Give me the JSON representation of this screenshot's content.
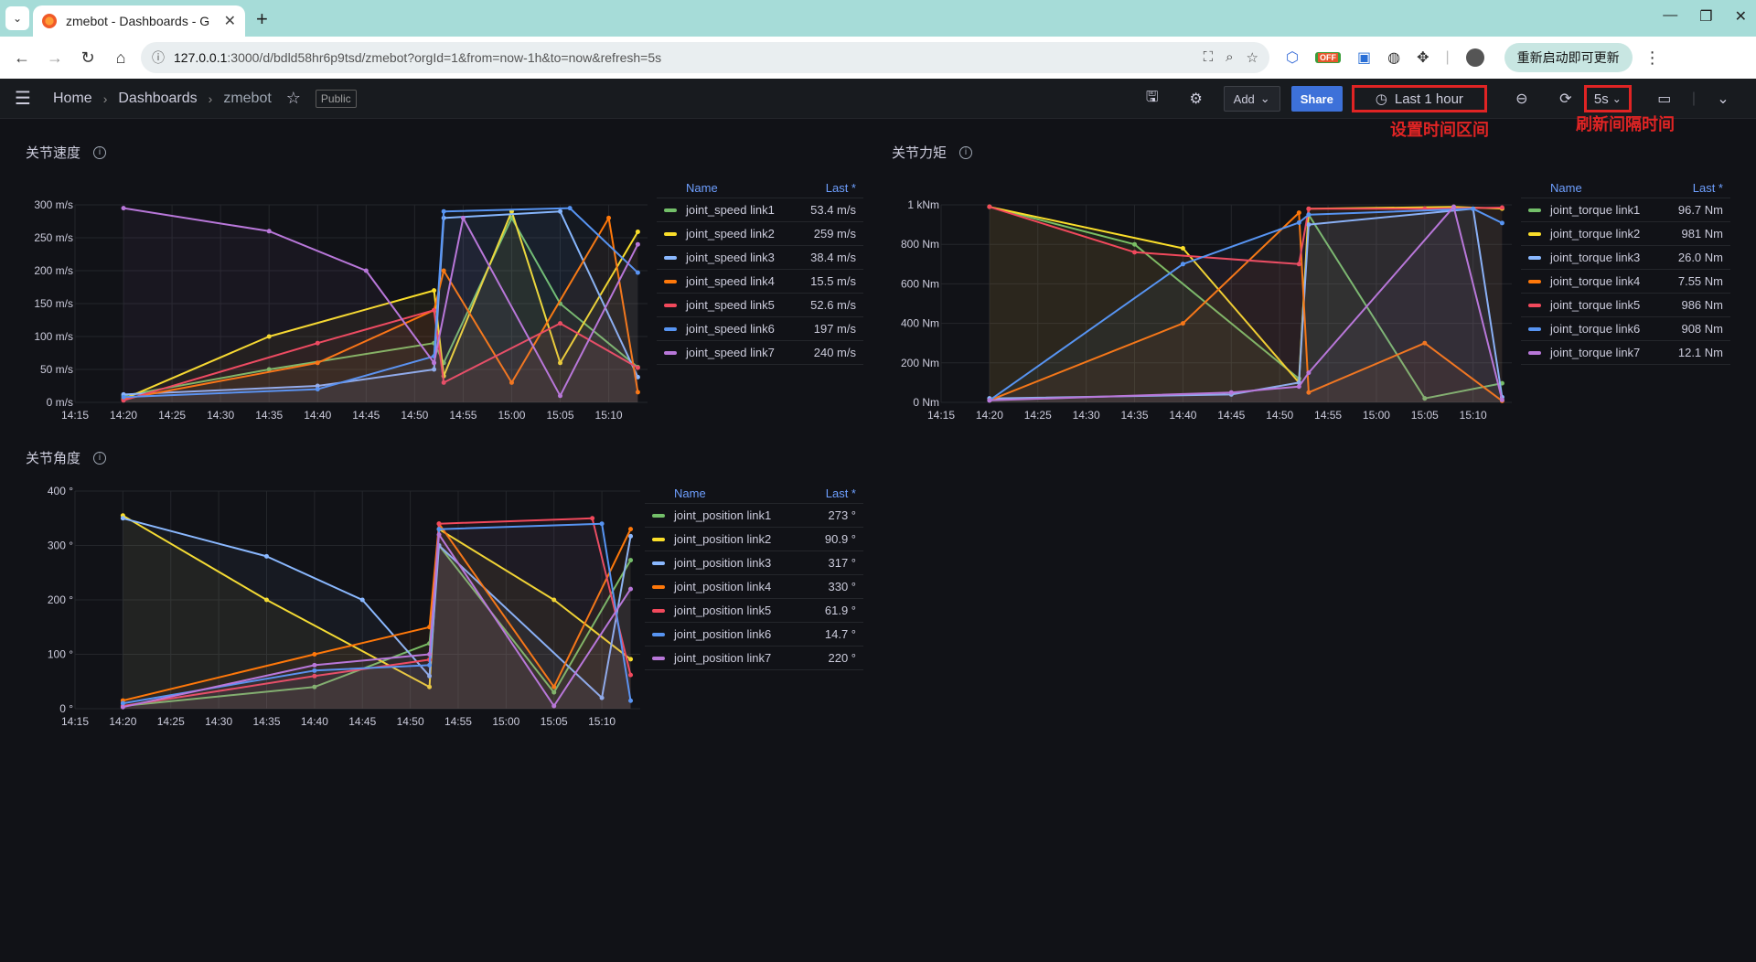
{
  "browser": {
    "tab_title": "zmebot - Dashboards - G",
    "url_host": "127.0.0.1",
    "url_path": ":3000/d/bdld58hr6p9tsd/zmebot?orgId=1&from=now-1h&to=now&refresh=5s",
    "update_button": "重新启动即可更新",
    "ext_off_label": "OFF"
  },
  "nav": {
    "home": "Home",
    "dashboards": "Dashboards",
    "dashboard_name": "zmebot",
    "public_badge": "Public",
    "add_label": "Add",
    "share_label": "Share",
    "time_range": "Last 1 hour",
    "refresh_interval": "5s"
  },
  "annotations": {
    "time_range_note": "设置时间区间",
    "refresh_note": "刷新间隔时间"
  },
  "colors": {
    "link1": "#73bf69",
    "link2": "#fade2a",
    "link3": "#8ab8ff",
    "link4": "#ff780a",
    "link5": "#f2495c",
    "link6": "#5794f2",
    "link7": "#b877d9"
  },
  "panels": [
    {
      "title": "关节速度",
      "legend_name_header": "Name",
      "legend_last_header": "Last *",
      "legend": [
        {
          "name": "joint_speed link1",
          "value": "53.4 m/s"
        },
        {
          "name": "joint_speed link2",
          "value": "259 m/s"
        },
        {
          "name": "joint_speed link3",
          "value": "38.4 m/s"
        },
        {
          "name": "joint_speed link4",
          "value": "15.5 m/s"
        },
        {
          "name": "joint_speed link5",
          "value": "52.6 m/s"
        },
        {
          "name": "joint_speed link6",
          "value": "197 m/s"
        },
        {
          "name": "joint_speed link7",
          "value": "240 m/s"
        }
      ]
    },
    {
      "title": "关节力矩",
      "legend_name_header": "Name",
      "legend_last_header": "Last *",
      "legend": [
        {
          "name": "joint_torque link1",
          "value": "96.7 Nm"
        },
        {
          "name": "joint_torque link2",
          "value": "981 Nm"
        },
        {
          "name": "joint_torque link3",
          "value": "26.0 Nm"
        },
        {
          "name": "joint_torque link4",
          "value": "7.55 Nm"
        },
        {
          "name": "joint_torque link5",
          "value": "986 Nm"
        },
        {
          "name": "joint_torque link6",
          "value": "908 Nm"
        },
        {
          "name": "joint_torque link7",
          "value": "12.1 Nm"
        }
      ]
    },
    {
      "title": "关节角度",
      "legend_name_header": "Name",
      "legend_last_header": "Last *",
      "legend": [
        {
          "name": "joint_position link1",
          "value": "273 °"
        },
        {
          "name": "joint_position link2",
          "value": "90.9 °"
        },
        {
          "name": "joint_position link3",
          "value": "317 °"
        },
        {
          "name": "joint_position link4",
          "value": "330 °"
        },
        {
          "name": "joint_position link5",
          "value": "61.9 °"
        },
        {
          "name": "joint_position link6",
          "value": "14.7 °"
        },
        {
          "name": "joint_position link7",
          "value": "220 °"
        }
      ]
    }
  ],
  "chart_data": [
    {
      "type": "line",
      "x_ticks": [
        "14:15",
        "14:20",
        "14:25",
        "14:30",
        "14:35",
        "14:40",
        "14:45",
        "14:50",
        "14:55",
        "15:00",
        "15:05",
        "15:10"
      ],
      "y_ticks": [
        "0 m/s",
        "50 m/s",
        "100 m/s",
        "150 m/s",
        "200 m/s",
        "250 m/s",
        "300 m/s"
      ],
      "ylim": [
        0,
        300
      ],
      "grid": true,
      "legend_placement": "right",
      "series": [
        {
          "name": "joint_speed link1",
          "points": [
            [
              "14:20",
              10
            ],
            [
              "14:35",
              50
            ],
            [
              "14:52",
              90
            ],
            [
              "14:53",
              60
            ],
            [
              "15:00",
              280
            ],
            [
              "15:05",
              150
            ],
            [
              "15:13",
              53.4
            ]
          ]
        },
        {
          "name": "joint_speed link2",
          "points": [
            [
              "14:20",
              5
            ],
            [
              "14:35",
              100
            ],
            [
              "14:52",
              170
            ],
            [
              "14:53",
              40
            ],
            [
              "15:00",
              290
            ],
            [
              "15:05",
              60
            ],
            [
              "15:13",
              259
            ]
          ]
        },
        {
          "name": "joint_speed link3",
          "points": [
            [
              "14:20",
              12
            ],
            [
              "14:40",
              25
            ],
            [
              "14:52",
              50
            ],
            [
              "14:53",
              280
            ],
            [
              "15:05",
              290
            ],
            [
              "15:13",
              38.4
            ]
          ]
        },
        {
          "name": "joint_speed link4",
          "points": [
            [
              "14:20",
              5
            ],
            [
              "14:40",
              60
            ],
            [
              "14:52",
              140
            ],
            [
              "14:53",
              200
            ],
            [
              "15:00",
              30
            ],
            [
              "15:10",
              280
            ],
            [
              "15:13",
              15.5
            ]
          ]
        },
        {
          "name": "joint_speed link5",
          "points": [
            [
              "14:20",
              3
            ],
            [
              "14:40",
              90
            ],
            [
              "14:52",
              140
            ],
            [
              "14:53",
              30
            ],
            [
              "15:05",
              120
            ],
            [
              "15:13",
              52.6
            ]
          ]
        },
        {
          "name": "joint_speed link6",
          "points": [
            [
              "14:20",
              8
            ],
            [
              "14:40",
              20
            ],
            [
              "14:52",
              70
            ],
            [
              "14:53",
              290
            ],
            [
              "15:06",
              295
            ],
            [
              "15:13",
              197
            ]
          ]
        },
        {
          "name": "joint_speed link7",
          "points": [
            [
              "14:20",
              295
            ],
            [
              "14:35",
              260
            ],
            [
              "14:45",
              200
            ],
            [
              "14:52",
              60
            ],
            [
              "14:55",
              280
            ],
            [
              "15:05",
              10
            ],
            [
              "15:13",
              240
            ]
          ]
        }
      ]
    },
    {
      "type": "line",
      "x_ticks": [
        "14:15",
        "14:20",
        "14:25",
        "14:30",
        "14:35",
        "14:40",
        "14:45",
        "14:50",
        "14:55",
        "15:00",
        "15:05",
        "15:10"
      ],
      "y_ticks": [
        "0 Nm",
        "200 Nm",
        "400 Nm",
        "600 Nm",
        "800 Nm",
        "1 kNm"
      ],
      "ylim": [
        0,
        1000
      ],
      "grid": true,
      "legend_placement": "right",
      "series": [
        {
          "name": "joint_torque link1",
          "points": [
            [
              "14:20",
              990
            ],
            [
              "14:35",
              800
            ],
            [
              "14:52",
              120
            ],
            [
              "14:53",
              950
            ],
            [
              "15:05",
              20
            ],
            [
              "15:13",
              96.7
            ]
          ]
        },
        {
          "name": "joint_torque link2",
          "points": [
            [
              "14:20",
              990
            ],
            [
              "14:40",
              780
            ],
            [
              "14:52",
              100
            ],
            [
              "14:53",
              980
            ],
            [
              "15:08",
              990
            ],
            [
              "15:13",
              981
            ]
          ]
        },
        {
          "name": "joint_torque link3",
          "points": [
            [
              "14:20",
              20
            ],
            [
              "14:45",
              40
            ],
            [
              "14:52",
              100
            ],
            [
              "14:53",
              900
            ],
            [
              "15:10",
              980
            ],
            [
              "15:13",
              26.0
            ]
          ]
        },
        {
          "name": "joint_torque link4",
          "points": [
            [
              "14:20",
              10
            ],
            [
              "14:40",
              400
            ],
            [
              "14:52",
              960
            ],
            [
              "14:53",
              50
            ],
            [
              "15:05",
              300
            ],
            [
              "15:13",
              7.55
            ]
          ]
        },
        {
          "name": "joint_torque link5",
          "points": [
            [
              "14:20",
              990
            ],
            [
              "14:35",
              760
            ],
            [
              "14:52",
              700
            ],
            [
              "14:53",
              980
            ],
            [
              "15:05",
              980
            ],
            [
              "15:13",
              986
            ]
          ]
        },
        {
          "name": "joint_torque link6",
          "points": [
            [
              "14:20",
              10
            ],
            [
              "14:40",
              700
            ],
            [
              "14:52",
              910
            ],
            [
              "14:53",
              950
            ],
            [
              "15:10",
              980
            ],
            [
              "15:13",
              908
            ]
          ]
        },
        {
          "name": "joint_torque link7",
          "points": [
            [
              "14:20",
              10
            ],
            [
              "14:45",
              50
            ],
            [
              "14:52",
              80
            ],
            [
              "14:53",
              150
            ],
            [
              "15:08",
              990
            ],
            [
              "15:13",
              12.1
            ]
          ]
        }
      ]
    },
    {
      "type": "line",
      "x_ticks": [
        "14:15",
        "14:20",
        "14:25",
        "14:30",
        "14:35",
        "14:40",
        "14:45",
        "14:50",
        "14:55",
        "15:00",
        "15:05",
        "15:10"
      ],
      "y_ticks": [
        "0 °",
        "100 °",
        "200 °",
        "300 °",
        "400 °"
      ],
      "ylim": [
        0,
        400
      ],
      "grid": true,
      "legend_placement": "right",
      "series": [
        {
          "name": "joint_position link1",
          "points": [
            [
              "14:20",
              5
            ],
            [
              "14:40",
              40
            ],
            [
              "14:52",
              120
            ],
            [
              "14:53",
              300
            ],
            [
              "15:05",
              30
            ],
            [
              "15:13",
              273
            ]
          ]
        },
        {
          "name": "joint_position link2",
          "points": [
            [
              "14:20",
              355
            ],
            [
              "14:35",
              200
            ],
            [
              "14:52",
              40
            ],
            [
              "14:53",
              330
            ],
            [
              "15:05",
              200
            ],
            [
              "15:13",
              90.9
            ]
          ]
        },
        {
          "name": "joint_position link3",
          "points": [
            [
              "14:20",
              350
            ],
            [
              "14:35",
              280
            ],
            [
              "14:45",
              200
            ],
            [
              "14:52",
              60
            ],
            [
              "14:53",
              300
            ],
            [
              "15:10",
              20
            ],
            [
              "15:13",
              317
            ]
          ]
        },
        {
          "name": "joint_position link4",
          "points": [
            [
              "14:20",
              15
            ],
            [
              "14:40",
              100
            ],
            [
              "14:52",
              150
            ],
            [
              "14:53",
              340
            ],
            [
              "15:05",
              40
            ],
            [
              "15:13",
              330
            ]
          ]
        },
        {
          "name": "joint_position link5",
          "points": [
            [
              "14:20",
              5
            ],
            [
              "14:40",
              60
            ],
            [
              "14:52",
              90
            ],
            [
              "14:53",
              340
            ],
            [
              "15:09",
              350
            ],
            [
              "15:13",
              61.9
            ]
          ]
        },
        {
          "name": "joint_position link6",
          "points": [
            [
              "14:20",
              10
            ],
            [
              "14:40",
              70
            ],
            [
              "14:52",
              80
            ],
            [
              "14:53",
              330
            ],
            [
              "15:10",
              340
            ],
            [
              "15:13",
              14.7
            ]
          ]
        },
        {
          "name": "joint_position link7",
          "points": [
            [
              "14:20",
              3
            ],
            [
              "14:40",
              80
            ],
            [
              "14:52",
              100
            ],
            [
              "14:53",
              320
            ],
            [
              "15:05",
              5
            ],
            [
              "15:13",
              220
            ]
          ]
        }
      ]
    }
  ]
}
